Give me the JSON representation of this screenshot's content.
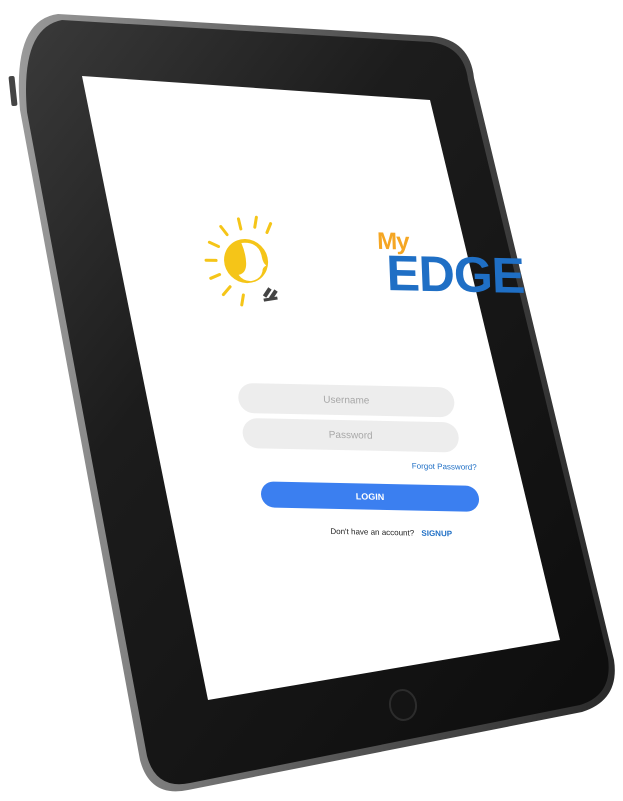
{
  "app": {
    "logo_my": "My",
    "logo_edge": "EDGE"
  },
  "login_form": {
    "username_placeholder": "Username",
    "password_placeholder": "Password",
    "forgot_password": "Forgot Password?",
    "login_button": "LOGIN",
    "no_account_text": "Don't have an account?",
    "signup_link": "SIGNUP"
  },
  "colors": {
    "brand_blue": "#1f6fc5",
    "brand_yellow": "#f5c518",
    "button_blue": "#3b7ff0",
    "field_bg": "#ededed",
    "bezel": "#1b1b1b"
  }
}
